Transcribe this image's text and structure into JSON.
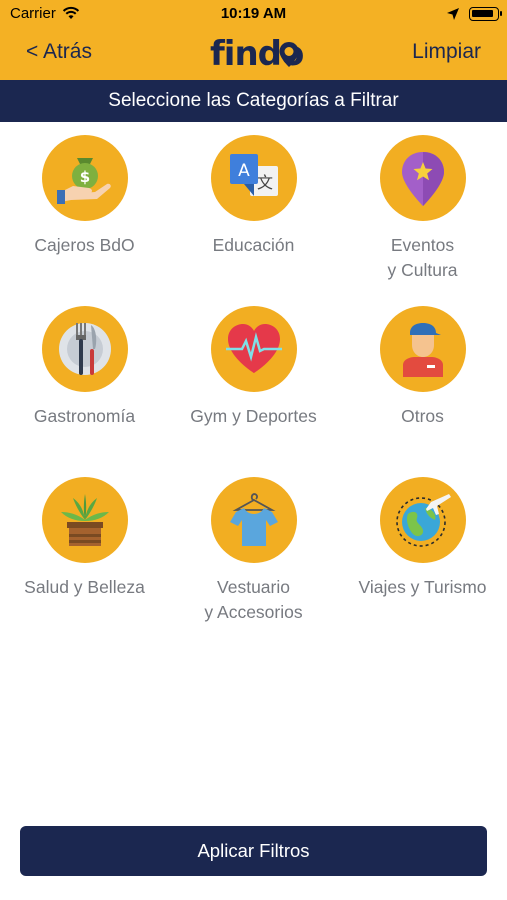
{
  "status_bar": {
    "carrier": "Carrier",
    "time": "10:19 AM"
  },
  "nav": {
    "back_label": "< Atrás",
    "logo_text": "findo",
    "clear_label": "Limpiar"
  },
  "banner": {
    "title": "Seleccione las Categorías a Filtrar"
  },
  "categories": [
    {
      "label": "Cajeros BdO",
      "icon": "money-hand-icon"
    },
    {
      "label": "Educación",
      "icon": "translate-icon"
    },
    {
      "label": "Eventos\ny Cultura",
      "icon": "map-pin-star-icon"
    },
    {
      "label": "Gastronomía",
      "icon": "plate-cutlery-icon"
    },
    {
      "label": "Gym y Deportes",
      "icon": "heart-pulse-icon"
    },
    {
      "label": "Otros",
      "icon": "delivery-person-icon"
    },
    {
      "label": "Salud y Belleza",
      "icon": "potted-plant-icon"
    },
    {
      "label": "Vestuario\ny Accesorios",
      "icon": "shirt-hanger-icon"
    },
    {
      "label": "Viajes y Turismo",
      "icon": "globe-plane-icon"
    }
  ],
  "apply_button": {
    "label": "Aplicar Filtros"
  },
  "colors": {
    "accent": "#f4b124",
    "navy": "#1b2750",
    "label_gray": "#777a80"
  }
}
